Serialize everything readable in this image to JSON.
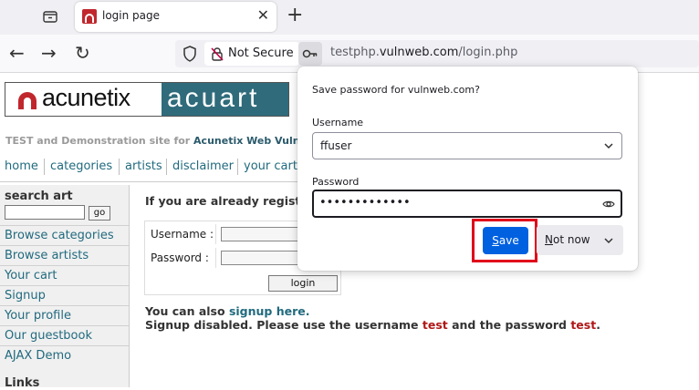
{
  "browser": {
    "tab": {
      "title": "login page",
      "close_glyph": "✕"
    },
    "new_tab_glyph": "+",
    "nav": {
      "back_glyph": "←",
      "forward_glyph": "→",
      "reload_glyph": "↻"
    },
    "url": {
      "security_label": "Not Secure",
      "host_prefix": "testphp.",
      "host_domain": "vulnweb.com",
      "path": "/login.php"
    }
  },
  "site": {
    "logo": {
      "left_text": "acunetix",
      "right_text": "acuart"
    },
    "tagline_prefix": "TEST and Demonstration site for ",
    "tagline_strong": "Acunetix Web Vulnerabi",
    "menu": [
      {
        "label": "home"
      },
      {
        "label": "categories"
      },
      {
        "label": "artists"
      },
      {
        "label": "disclaimer"
      },
      {
        "label": "your cart"
      }
    ],
    "sidebar": {
      "search_title": "search art",
      "search_button": "go",
      "links": [
        {
          "label": "Browse categories"
        },
        {
          "label": "Browse artists"
        },
        {
          "label": "Your cart"
        },
        {
          "label": "Signup"
        },
        {
          "label": "Your profile"
        },
        {
          "label": "Our guestbook"
        },
        {
          "label": "AJAX Demo"
        }
      ],
      "links_title": "Links"
    },
    "login": {
      "heading": "If you are already registere",
      "username_label": "Username :",
      "password_label": "Password :",
      "button": "login"
    },
    "signup_prefix": "You can also ",
    "signup_link": "signup here.",
    "disabled_prefix": "Signup disabled. Please use the username ",
    "disabled_user": "test",
    "disabled_mid": " and the password ",
    "disabled_pass": "test",
    "disabled_suffix": "."
  },
  "popup": {
    "title": "Save password for vulnweb.com?",
    "username_label": "Username",
    "username_value": "ffuser",
    "password_label": "Password",
    "password_value": "•••••••••••••",
    "save_button_first": "S",
    "save_button_rest": "ave",
    "not_now_first": "N",
    "not_now_rest": "ot now"
  },
  "colors": {
    "accent": "#0061e0",
    "highlight": "#e0001a",
    "site_link": "#216a7e"
  }
}
